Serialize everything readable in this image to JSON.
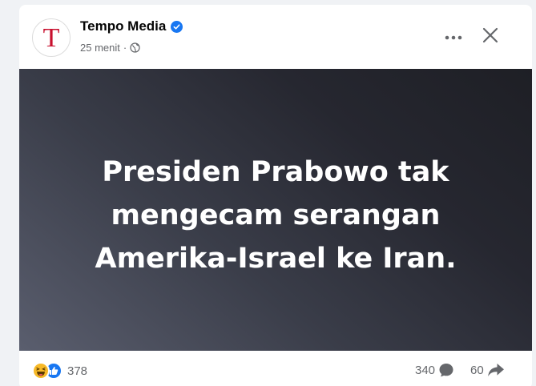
{
  "post": {
    "page_name": "Tempo Media",
    "avatar_letter": "T",
    "time": "25 menit",
    "separator": "·",
    "audience_icon": "globe-icon",
    "verified_icon": "verified-badge-icon",
    "image_text": "Presiden Prabowo tak mengecam serangan Amerika-Israel ke Iran."
  },
  "actions": {
    "more_icon": "more-options-icon",
    "close_icon": "close-icon"
  },
  "footer": {
    "reaction_icons": [
      "haha-reaction-icon",
      "like-reaction-icon"
    ],
    "reaction_count": "378",
    "comment_count": "340",
    "comment_icon": "comment-bubble-icon",
    "share_count": "60",
    "share_icon": "share-arrow-icon"
  },
  "colors": {
    "brand_red": "#c8102e",
    "verified_blue": "#1877f2",
    "secondary_text": "#65676b",
    "image_gradient_light": "#5a5e6e",
    "image_gradient_dark": "#1e1f25"
  }
}
